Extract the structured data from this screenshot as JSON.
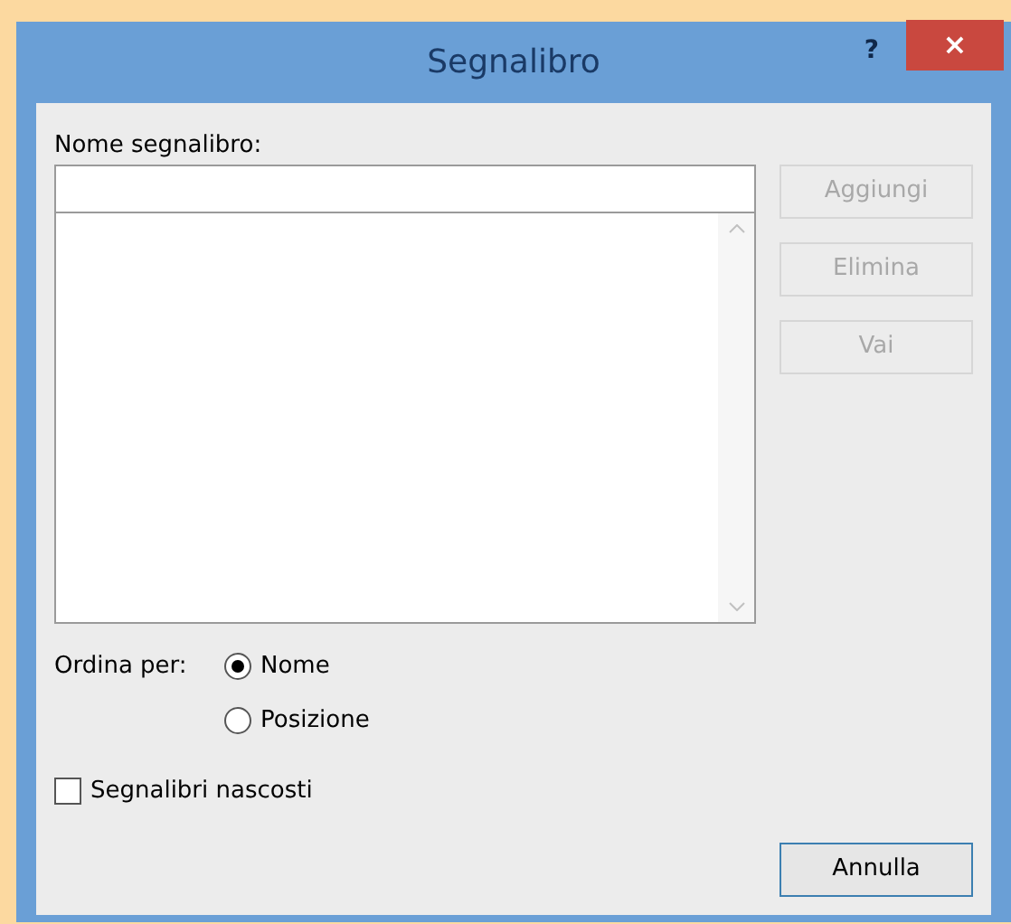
{
  "window": {
    "title": "Segnalibro",
    "help": "?",
    "close": "×"
  },
  "name_label": "Nome segnalibro:",
  "side_buttons": [
    {
      "label": "Aggiungi",
      "disabled": true
    },
    {
      "label": "Elimina",
      "disabled": true
    },
    {
      "label": "Vai",
      "disabled": true
    }
  ],
  "sort": {
    "label": "Ordina per:",
    "options": [
      {
        "label": "Nome",
        "selected": true
      },
      {
        "label": "Posizione",
        "selected": false
      }
    ]
  },
  "hidden_checkbox": {
    "label": "Segnalibri nascosti",
    "checked": false
  },
  "cancel_button": {
    "label": "Annulla",
    "disabled": false
  }
}
